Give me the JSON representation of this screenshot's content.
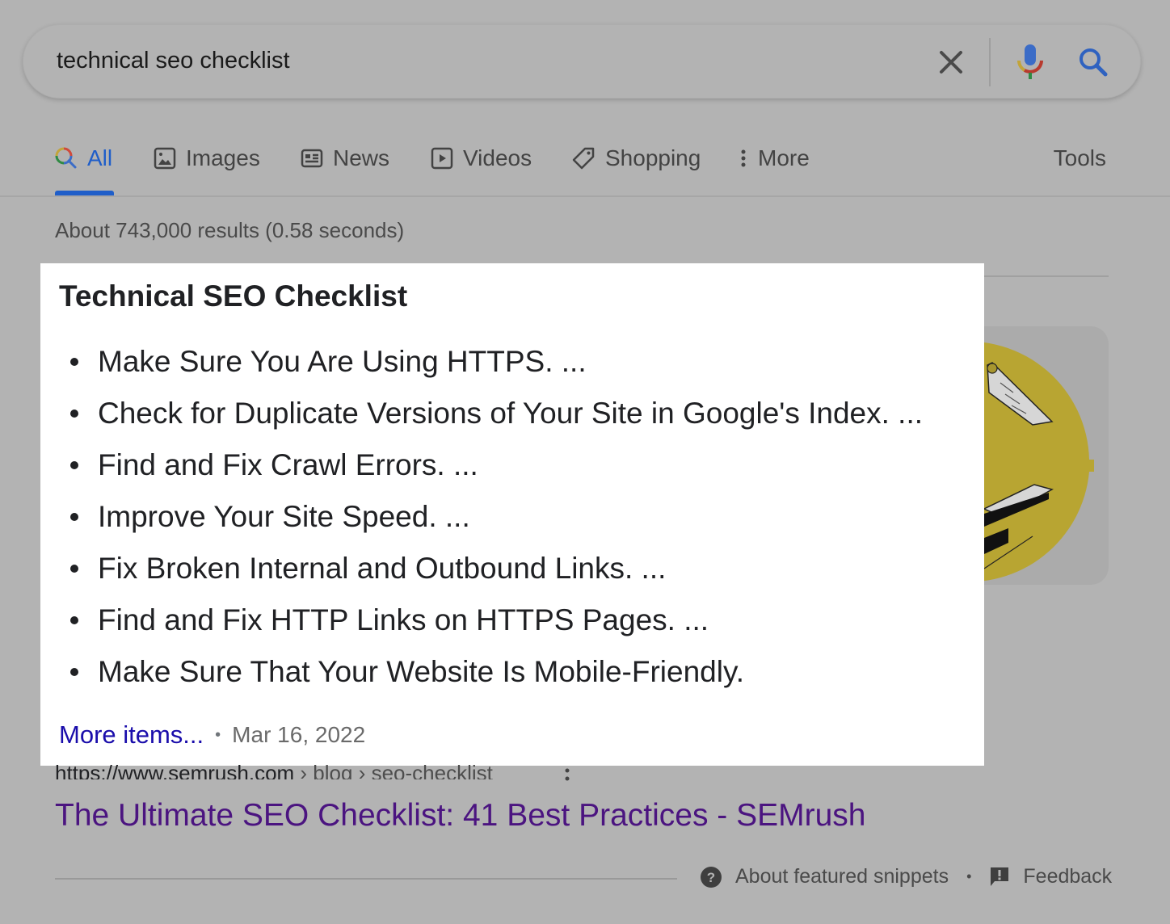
{
  "search": {
    "query": "technical seo checklist",
    "clear_icon": "close-icon",
    "mic_icon": "microphone-icon",
    "search_icon": "search-icon"
  },
  "tabs": [
    {
      "label": "All",
      "icon": "search-icon",
      "active": true
    },
    {
      "label": "Images",
      "icon": "image-icon",
      "active": false
    },
    {
      "label": "News",
      "icon": "newspaper-icon",
      "active": false
    },
    {
      "label": "Videos",
      "icon": "play-icon",
      "active": false
    },
    {
      "label": "Shopping",
      "icon": "tag-icon",
      "active": false
    },
    {
      "label": "More",
      "icon": "vertical-dots-icon",
      "active": false
    }
  ],
  "tools_label": "Tools",
  "results_stats": "About 743,000 results (0.58 seconds)",
  "snippet": {
    "title": "Technical SEO Checklist",
    "items": [
      "Make Sure You Are Using HTTPS. ...",
      "Check for Duplicate Versions of Your Site in Google's Index. ...",
      "Find and Fix Crawl Errors. ...",
      "Improve Your Site Speed. ...",
      "Fix Broken Internal and Outbound Links. ...",
      "Find and Fix HTTP Links on HTTPS Pages. ...",
      "Make Sure That Your Website Is Mobile-Friendly."
    ],
    "more_items": "More items...",
    "separator": "•",
    "date": "Mar 16, 2022"
  },
  "result": {
    "url_domain": "https://www.semrush.com",
    "url_path": " › blog › seo-checklist",
    "title": "The Ultimate SEO Checklist: 41 Best Practices - SEMrush"
  },
  "footer": {
    "about_label": "About featured snippets",
    "separator": "•",
    "feedback_label": "Feedback"
  },
  "colors": {
    "accent_blue": "#1f5ec9",
    "link_blue": "#1a0dab",
    "visited_purple": "#4b1480",
    "overlay_gray": "#b3b3b3",
    "thumbnail_yellow": "#b8a532"
  }
}
